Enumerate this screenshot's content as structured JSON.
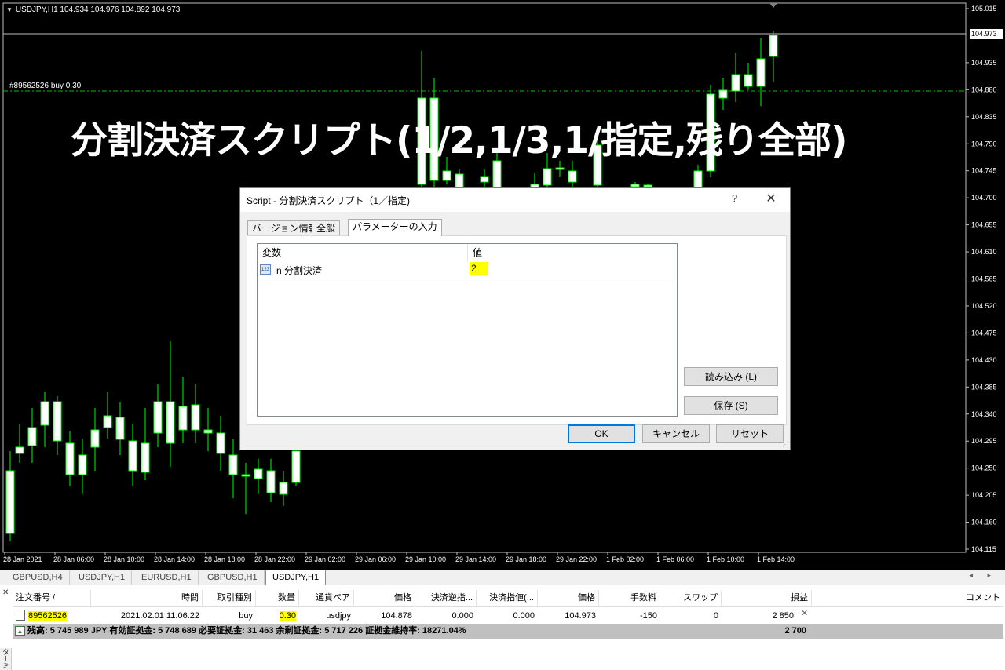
{
  "chart": {
    "symbol_title": "USDJPY,H1  104.934 104.976 104.892 104.973",
    "order_label": "#89562526 buy 0.30",
    "overlay_title": "分割決済スクリプト(1/2,1/3,1/指定,残り全部)",
    "current_price": "104.973",
    "price_axis": [
      "105.015",
      "104.973",
      "104.935",
      "104.880",
      "104.835",
      "104.790",
      "104.745",
      "104.700",
      "104.655",
      "104.610",
      "104.565",
      "104.520",
      "104.475",
      "104.430",
      "104.385",
      "104.340",
      "104.295",
      "104.250",
      "104.205",
      "104.160",
      "104.115"
    ],
    "time_axis": [
      "28 Jan 2021",
      "28 Jan 06:00",
      "28 Jan 10:00",
      "28 Jan 14:00",
      "28 Jan 18:00",
      "28 Jan 22:00",
      "29 Jan 02:00",
      "29 Jan 06:00",
      "29 Jan 10:00",
      "29 Jan 14:00",
      "29 Jan 18:00",
      "29 Jan 22:00",
      "1 Feb 02:00",
      "1 Feb 06:00",
      "1 Feb 10:00",
      "1 Feb 14:00"
    ],
    "colors": {
      "background": "#000000",
      "candle_up": "#000000",
      "candle_down": "#ffffff",
      "wick": "#00ff00",
      "grid_line": "#c0c0c0"
    }
  },
  "dialog": {
    "title": "Script - 分割決済スクリプト（1／指定)",
    "help_label": "?",
    "close_label": "✕",
    "tabs": [
      {
        "label": "バージョン情報",
        "active": false
      },
      {
        "label": "全般",
        "active": false
      },
      {
        "label": "パラメーターの入力",
        "active": true
      }
    ],
    "table_headers": {
      "variable": "変数",
      "value": "値"
    },
    "params": [
      {
        "icon": "123",
        "name": "n 分割決済",
        "value": "2"
      }
    ],
    "buttons": {
      "load": "読み込み (L)",
      "save": "保存 (S)",
      "ok": "OK",
      "cancel": "キャンセル",
      "reset": "リセット"
    }
  },
  "chart_tabs": {
    "items": [
      {
        "label": "GBPUSD,H4",
        "active": false
      },
      {
        "label": "USDJPY,H1",
        "active": false
      },
      {
        "label": "EURUSD,H1",
        "active": false
      },
      {
        "label": "GBPUSD,H1",
        "active": false
      },
      {
        "label": "USDJPY,H1",
        "active": true
      }
    ],
    "arrows": "◂ ▸"
  },
  "terminal": {
    "close_label": "✕",
    "side_label": "ターミナル",
    "headers": [
      "注文番号  /",
      "時間",
      "取引種別",
      "数量",
      "通貨ペア",
      "価格",
      "決済逆指...",
      "決済指値(...",
      "価格",
      "手数料",
      "スワップ",
      "損益",
      "コメント"
    ],
    "row": {
      "ticket": "89562526",
      "time": "2021.02.01 11:06:22",
      "type": "buy",
      "volume": "0.30",
      "symbol": "usdjpy",
      "open_price": "104.878",
      "sl": "0.000",
      "tp": "0.000",
      "price": "104.973",
      "commission": "-150",
      "swap": "0",
      "profit": "2 850",
      "comment": ""
    },
    "balance_text": "残高: 5 745 989 JPY  有効証拠金: 5 748 689  必要証拠金: 31 463  余剰証拠金: 5 717 226  証拠金維持率: 18271.04%",
    "balance_profit": "2 700"
  }
}
